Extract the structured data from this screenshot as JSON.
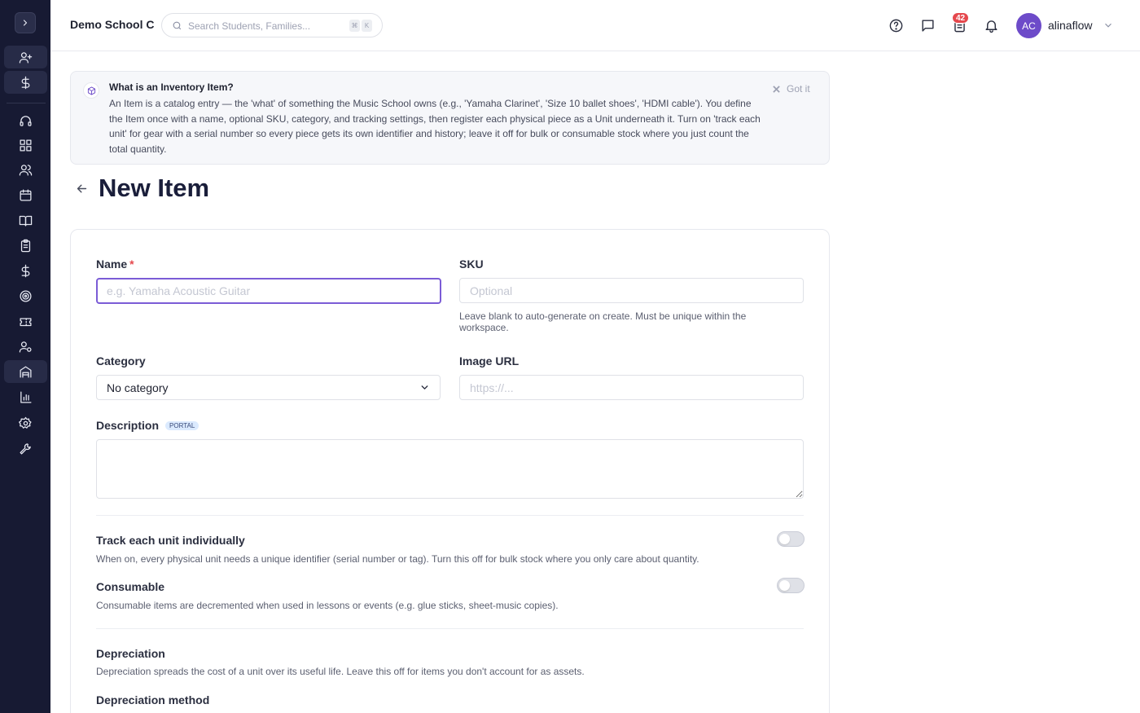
{
  "app": {
    "school_name": "Demo School C",
    "search": {
      "placeholder": "Search Students, Families...",
      "kbd_mod": "⌘",
      "kbd_key": "K"
    },
    "badge_count": "42",
    "user": {
      "initials": "AC",
      "name": "alinaflow"
    }
  },
  "sidebar": {
    "toggle_icon": "chevron-right-icon",
    "items": [
      {
        "icon": "user-plus-icon"
      },
      {
        "icon": "dollar-icon"
      },
      {
        "icon": "headset-icon"
      },
      {
        "icon": "dashboard-icon"
      },
      {
        "icon": "users-icon"
      },
      {
        "icon": "calendar-icon"
      },
      {
        "icon": "book-open-icon"
      },
      {
        "icon": "clipboard-icon"
      },
      {
        "icon": "dollar-icon"
      },
      {
        "icon": "target-icon"
      },
      {
        "icon": "ticket-icon"
      },
      {
        "icon": "user-gear-icon"
      },
      {
        "icon": "inventory-icon"
      },
      {
        "icon": "bar-chart-icon"
      },
      {
        "icon": "settings-icon"
      },
      {
        "icon": "wrench-icon"
      }
    ]
  },
  "banner": {
    "title": "What is an Inventory Item?",
    "text": "An Item is a catalog entry — the 'what' of something the Music School owns (e.g., 'Yamaha Clarinet', 'Size 10 ballet shoes', 'HDMI cable'). You define the Item once with a name, optional SKU, category, and tracking settings, then register each physical piece as a Unit underneath it. Turn on 'track each unit' for gear with a serial number so every piece gets its own identifier and history; leave it off for bulk or consumable stock where you just count the total quantity.",
    "dismiss_label": "Got it"
  },
  "page": {
    "title": "New Item"
  },
  "form": {
    "name": {
      "label": "Name",
      "required_mark": "*",
      "placeholder": "e.g. Yamaha Acoustic Guitar",
      "value": ""
    },
    "sku": {
      "label": "SKU",
      "placeholder": "Optional",
      "value": "",
      "help": "Leave blank to auto-generate on create. Must be unique within the workspace."
    },
    "category": {
      "label": "Category",
      "selected": "No category"
    },
    "image_url": {
      "label": "Image URL",
      "placeholder": "https://...",
      "value": ""
    },
    "description": {
      "label": "Description",
      "badge": "PORTAL",
      "value": ""
    },
    "track_units": {
      "title": "Track each unit individually",
      "desc": "When on, every physical unit needs a unique identifier (serial number or tag). Turn this off for bulk stock where you only care about quantity.",
      "on": false
    },
    "consumable": {
      "title": "Consumable",
      "desc": "Consumable items are decremented when used in lessons or events (e.g. glue sticks, sheet-music copies).",
      "on": false
    },
    "depreciation": {
      "title": "Depreciation",
      "desc": "Depreciation spreads the cost of a unit over its useful life. Leave this off for items you don't account for as assets."
    },
    "depreciation_method": {
      "label": "Depreciation method"
    }
  },
  "colors": {
    "sidebar_bg": "#171a33",
    "accent": "#7b5cd6",
    "badge": "#e5484d",
    "avatar": "#6d4bc9"
  }
}
